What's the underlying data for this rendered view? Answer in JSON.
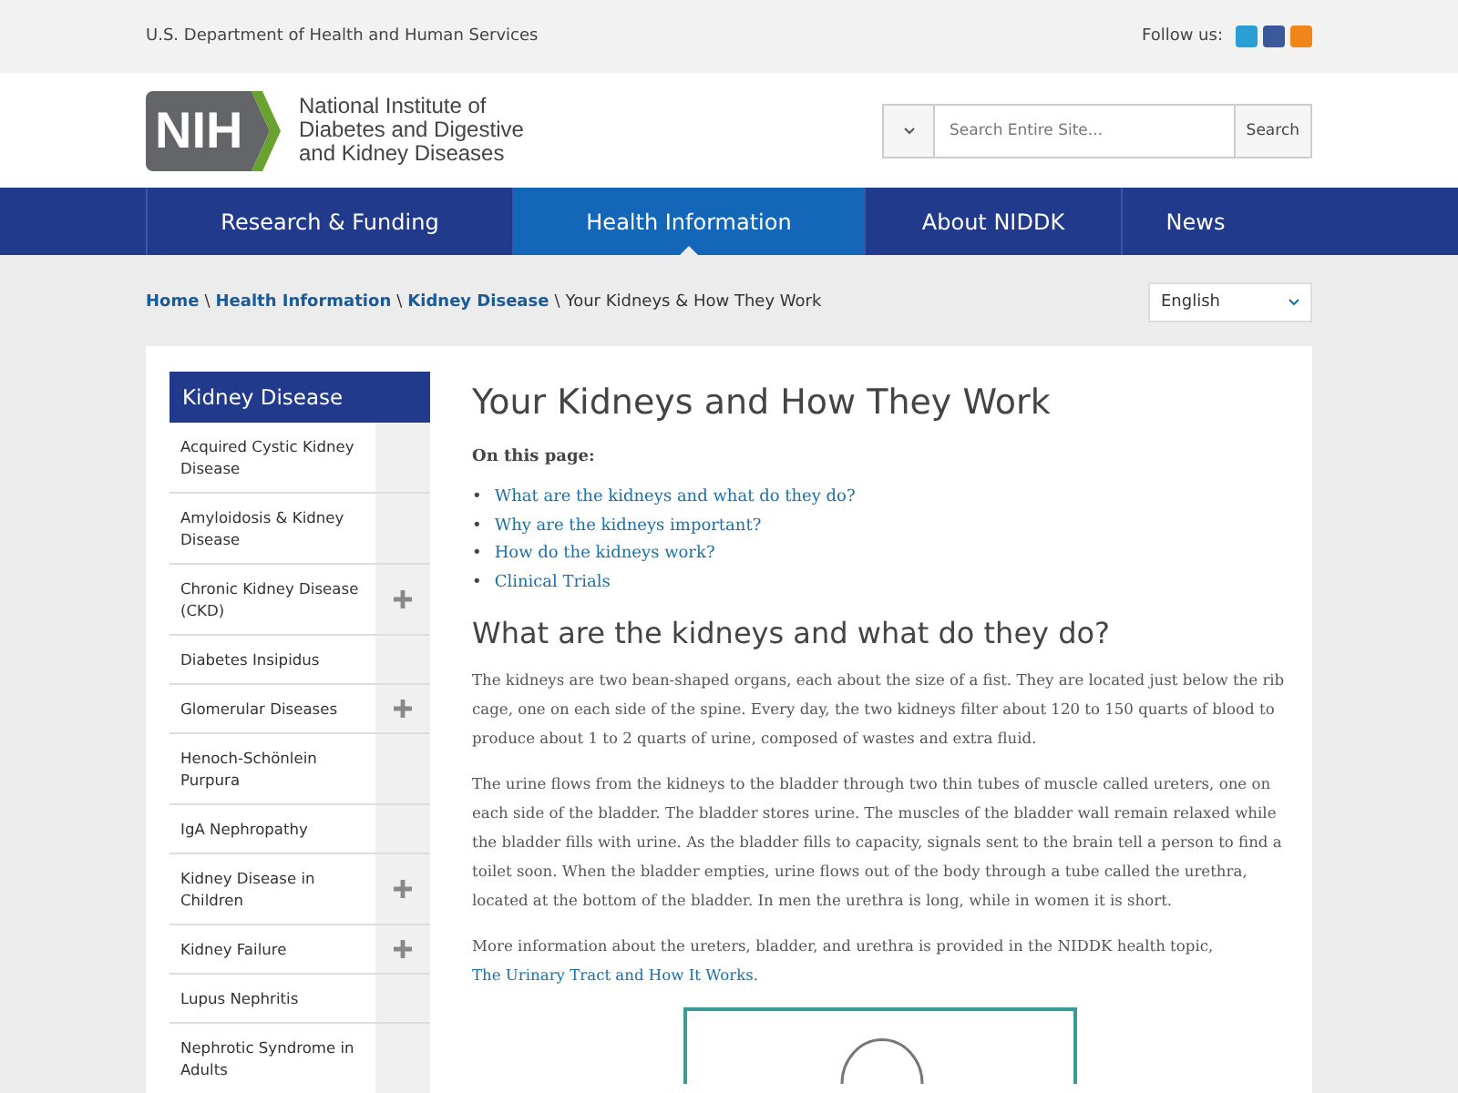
{
  "top_bar": {
    "agency": "U.S. Department of Health and Human Services",
    "follow_label": "Follow us:"
  },
  "header": {
    "logo_text": "NIH",
    "org_name": [
      "National Institute of",
      "Diabetes and Digestive",
      "and Kidney Diseases"
    ],
    "search": {
      "placeholder": "Search Entire Site...",
      "button": "Search"
    }
  },
  "nav": [
    {
      "label": "Research & Funding",
      "selected": false
    },
    {
      "label": "Health Information",
      "selected": true
    },
    {
      "label": "About NIDDK",
      "selected": false
    },
    {
      "label": "News",
      "selected": false
    }
  ],
  "breadcrumb": {
    "links": [
      "Home",
      "Health Information",
      "Kidney Disease"
    ],
    "separator": "\\",
    "current": "Your Kidneys & How They Work"
  },
  "language": "English",
  "sidebar": {
    "title": "Kidney Disease",
    "items": [
      {
        "label": "Acquired Cystic Kidney Disease",
        "expandable": false
      },
      {
        "label": "Amyloidosis & Kidney Disease",
        "expandable": false
      },
      {
        "label": "Chronic Kidney Disease (CKD)",
        "expandable": true
      },
      {
        "label": "Diabetes Insipidus",
        "expandable": false
      },
      {
        "label": "Glomerular Diseases",
        "expandable": true
      },
      {
        "label": "Henoch-Schönlein Purpura",
        "expandable": false
      },
      {
        "label": "IgA Nephropathy",
        "expandable": false
      },
      {
        "label": "Kidney Disease in Children",
        "expandable": true
      },
      {
        "label": "Kidney Failure",
        "expandable": true
      },
      {
        "label": "Lupus Nephritis",
        "expandable": false
      },
      {
        "label": "Nephrotic Syndrome in Adults",
        "expandable": false
      }
    ]
  },
  "article": {
    "title": "Your Kidneys and How They Work",
    "toc_label": "On this page:",
    "toc": [
      {
        "bullet": "•",
        "label": "What are the kidneys and what do they do?"
      },
      {
        "bullet": "•",
        "label": "Why are the kidneys important?"
      },
      {
        "bullet": "•",
        "label": "How do the kidneys work?"
      },
      {
        "bullet": "•",
        "label": "Clinical Trials"
      }
    ],
    "section_title": "What are the kidneys and what do they do?",
    "paragraphs": [
      {
        "text": "The kidneys are two bean-shaped organs, each about the size of a fist. They are located just below the rib cage, one on each side of the spine. Every day, the two kidneys filter about 120 to 150 quarts of blood to produce about 1 to 2 quarts of urine, composed of wastes and extra fluid."
      },
      {
        "text": "The urine flows from the kidneys to the bladder through two thin tubes of muscle called ureters, one on each side of the bladder. The bladder stores urine. The muscles of the bladder wall remain relaxed while the bladder fills with urine. As the bladder fills to capacity, signals sent to the brain tell a person to find a toilet soon. When the bladder empties, urine flows out of the body through a tube called the urethra, located at the bottom of the bladder. In men the urethra is long, while in women it is short."
      },
      {
        "text": "More information about the ureters, bladder, and urethra is provided in the NIDDK health topic,",
        "link": "The Urinary Tract and How It Works",
        "after": "."
      }
    ]
  }
}
